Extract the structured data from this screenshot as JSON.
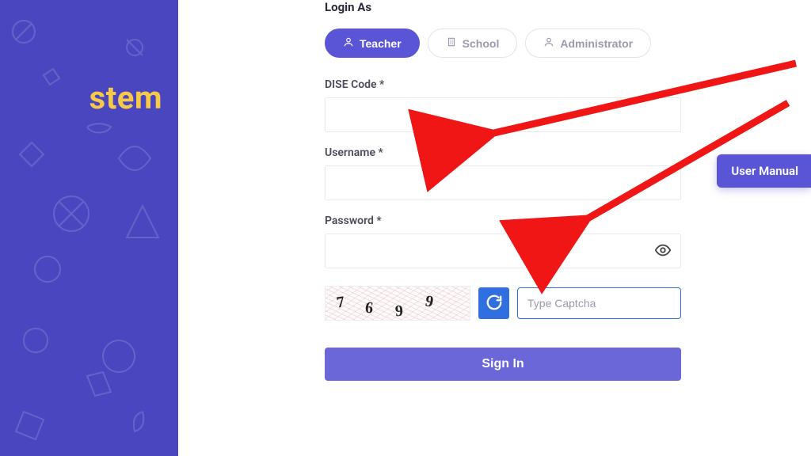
{
  "sidebar": {
    "title_fragment": "stem"
  },
  "form": {
    "login_as_label": "Login As",
    "roles": {
      "teacher": "Teacher",
      "school": "School",
      "administrator": "Administrator"
    },
    "fields": {
      "dise_code_label": "DISE Code *",
      "dise_code_value": "",
      "username_label": "Username *",
      "username_value": "",
      "password_label": "Password *",
      "password_value": ""
    },
    "captcha": {
      "chars": [
        "7",
        "6",
        "9",
        "9"
      ],
      "input_placeholder": "Type Captcha",
      "input_value": ""
    },
    "submit_label": "Sign In"
  },
  "floating": {
    "user_manual_label": "User Manual"
  },
  "annotations": {
    "arrow1_target": "dise-code-field",
    "arrow2_target": "username-field"
  }
}
